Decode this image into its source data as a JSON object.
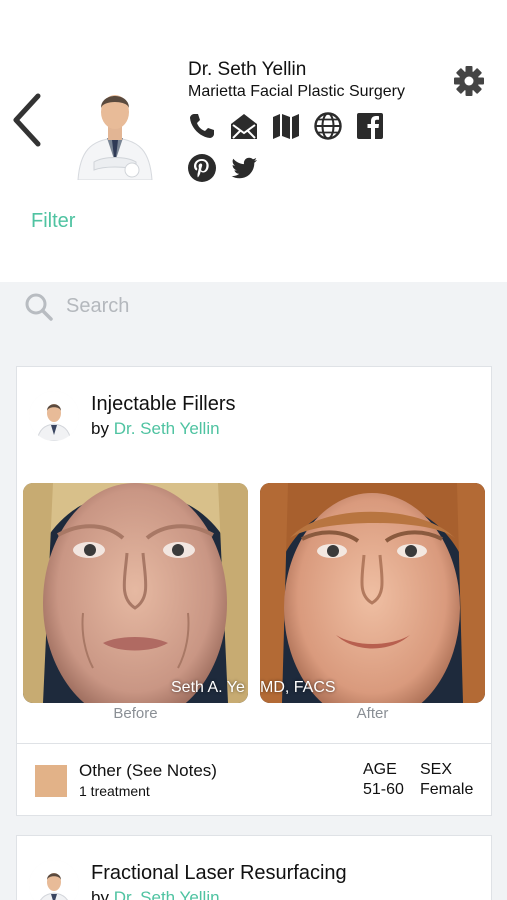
{
  "profile": {
    "name": "Dr. Seth Yellin",
    "practice": "Marietta Facial Plastic Surgery",
    "contact_icons": [
      "phone-icon",
      "mail-icon",
      "map-icon",
      "globe-icon",
      "facebook-icon"
    ],
    "social_icons": [
      "pinterest-icon",
      "twitter-icon"
    ]
  },
  "filter": {
    "label": "Filter"
  },
  "search": {
    "placeholder": "Search",
    "value": ""
  },
  "colors": {
    "accent": "#4fc3a1",
    "feed_bg": "#f1f3f5",
    "swatch": "#e2b288"
  },
  "cards": [
    {
      "title": "Injectable Fillers",
      "by_prefix": "by",
      "author": "Dr. Seth Yellin",
      "before_label": "Before",
      "after_label": "After",
      "watermark": "Seth A. Yellin MD, FACS",
      "watermark_left": "Seth A. Ye",
      "watermark_right": "MD, FACS",
      "treatment": "Other (See Notes)",
      "treatment_count": "1 treatment",
      "age_label": "AGE",
      "age_value": "51-60",
      "sex_label": "SEX",
      "sex_value": "Female"
    },
    {
      "title": "Fractional Laser Resurfacing",
      "by_prefix": "by",
      "author": "Dr. Seth Yellin"
    }
  ]
}
